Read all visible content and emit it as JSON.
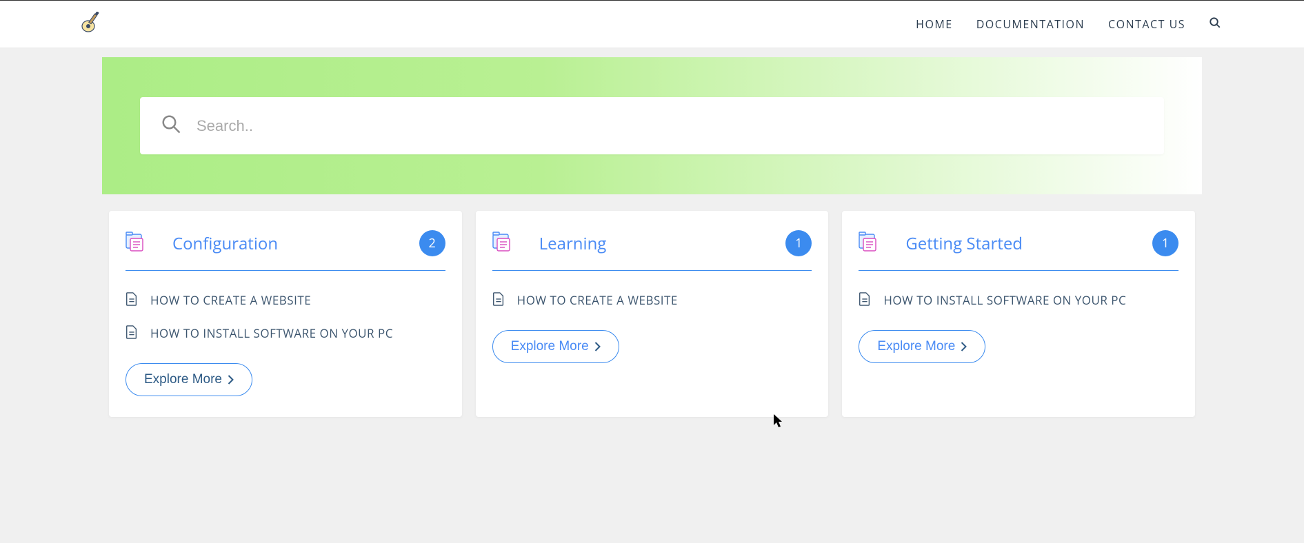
{
  "nav": {
    "home": "HOME",
    "documentation": "DOCUMENTATION",
    "contact": "CONTACT US"
  },
  "search": {
    "placeholder": "Search.."
  },
  "cards": [
    {
      "title": "Configuration",
      "count": "2",
      "articles": [
        "HOW TO CREATE A WEBSITE",
        "HOW TO INSTALL SOFTWARE ON YOUR PC"
      ],
      "button": "Explore More"
    },
    {
      "title": "Learning",
      "count": "1",
      "articles": [
        "HOW TO CREATE A WEBSITE"
      ],
      "button": "Explore More"
    },
    {
      "title": "Getting Started",
      "count": "1",
      "articles": [
        "HOW TO INSTALL SOFTWARE ON YOUR PC"
      ],
      "button": "Explore More"
    }
  ]
}
